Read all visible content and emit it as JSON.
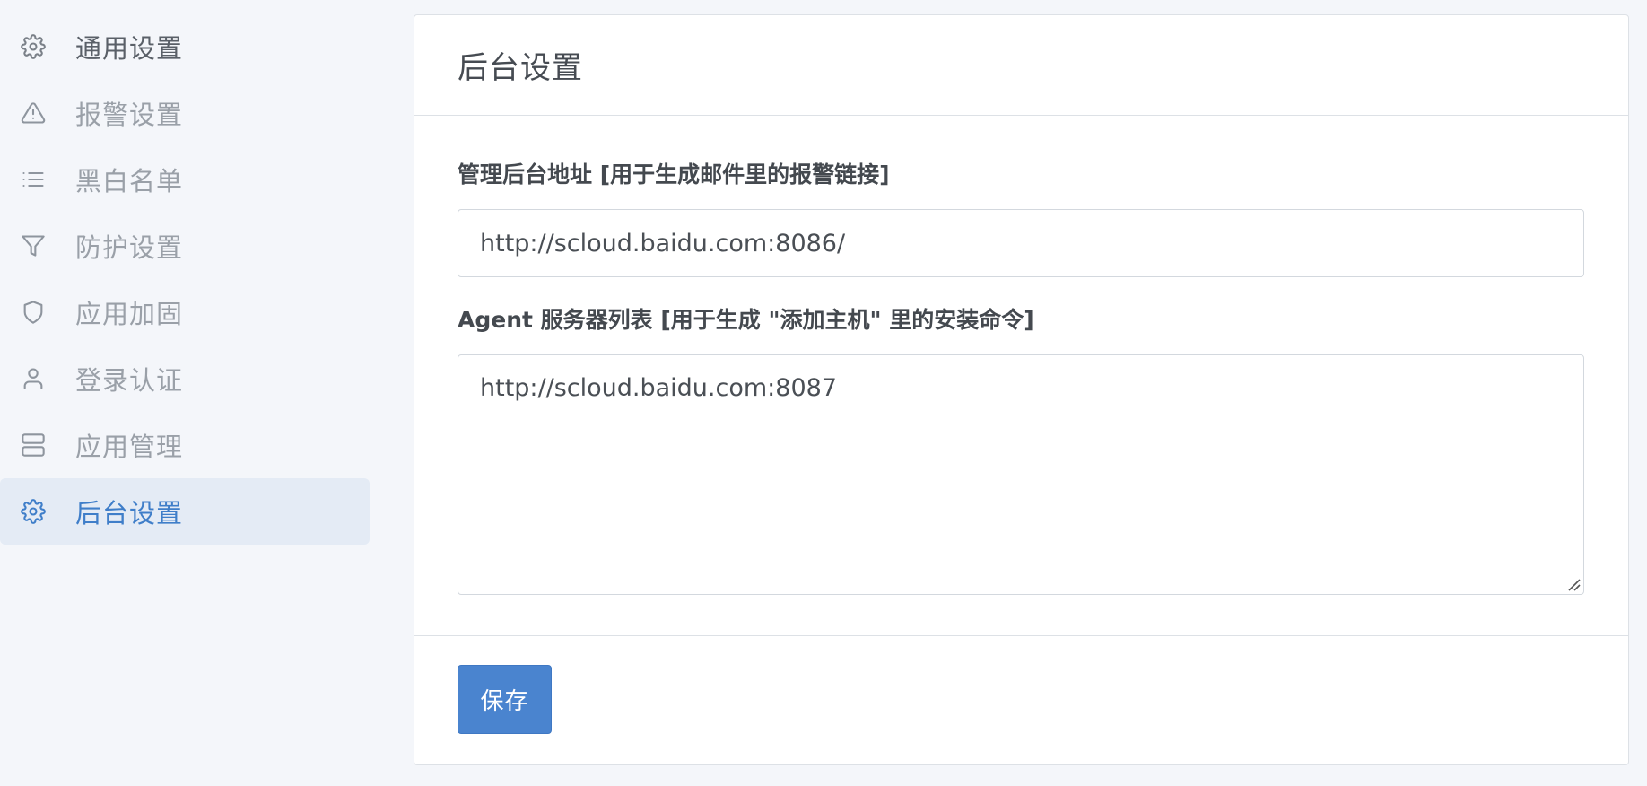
{
  "sidebar": {
    "items": [
      {
        "label": "通用设置",
        "icon": "gear-icon"
      },
      {
        "label": "报警设置",
        "icon": "alert-triangle-icon"
      },
      {
        "label": "黑白名单",
        "icon": "list-icon"
      },
      {
        "label": "防护设置",
        "icon": "filter-icon"
      },
      {
        "label": "应用加固",
        "icon": "shield-icon"
      },
      {
        "label": "登录认证",
        "icon": "user-icon"
      },
      {
        "label": "应用管理",
        "icon": "server-icon"
      },
      {
        "label": "后台设置",
        "icon": "gear-icon",
        "active": true
      }
    ]
  },
  "card": {
    "title": "后台设置",
    "admin_url_label": "管理后台地址 [用于生成邮件里的报警链接]",
    "admin_url_value": "http://scloud.baidu.com:8086/",
    "agent_servers_label": "Agent 服务器列表 [用于生成 \"添加主机\" 里的安装命令]",
    "agent_servers_value": "http://scloud.baidu.com:8087",
    "save_label": "保存"
  },
  "colors": {
    "accent": "#4a84cf",
    "active_text": "#3f7ec9",
    "active_bg": "#e4ebf5",
    "page_bg": "#f4f6fa"
  }
}
